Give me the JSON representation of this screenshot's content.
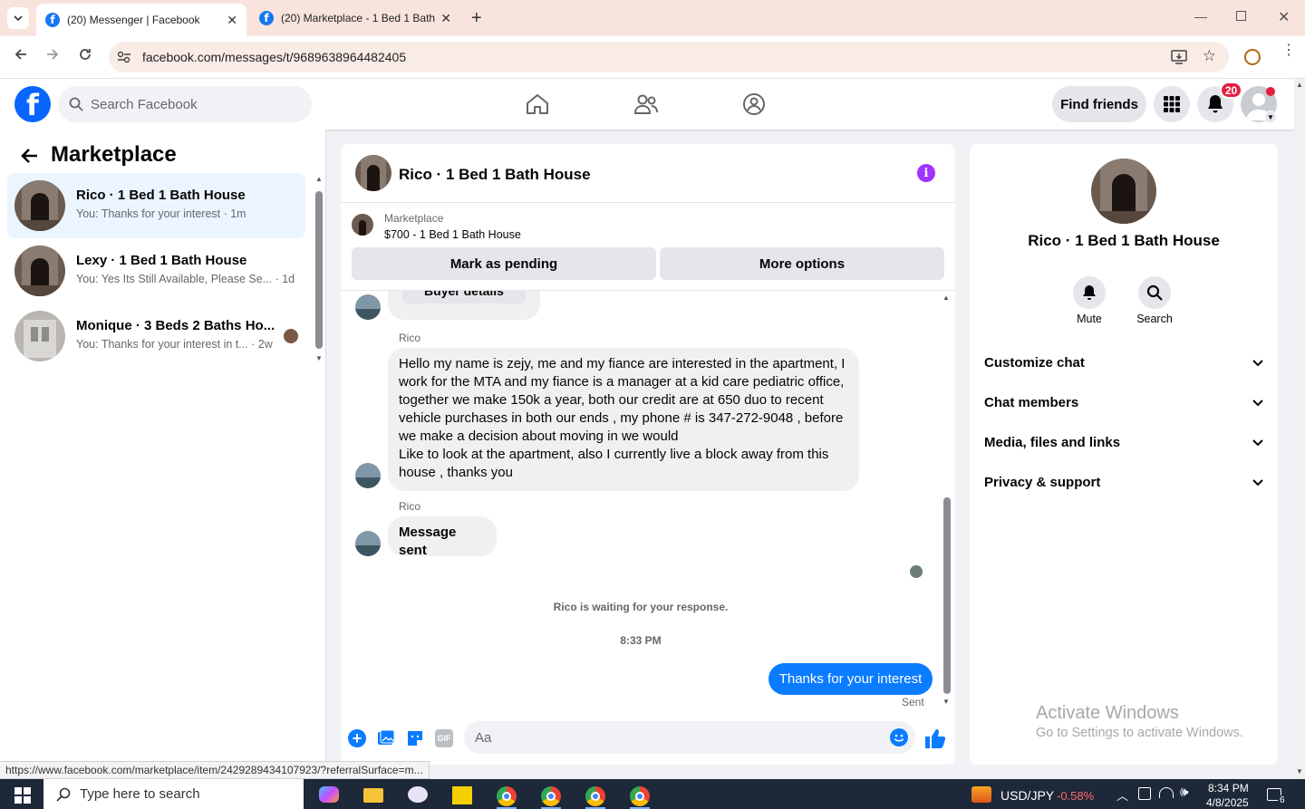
{
  "browser": {
    "tabs": [
      {
        "title": "(20) Messenger | Facebook",
        "active": true
      },
      {
        "title": "(20) Marketplace - 1 Bed 1 Bath",
        "active": false
      }
    ],
    "url": "facebook.com/messages/t/9689638964482405",
    "status_url": "https://www.facebook.com/marketplace/item/2429289434107923/?referralSurface=m..."
  },
  "fb": {
    "search_placeholder": "Search Facebook",
    "find_friends": "Find friends",
    "notification_count": "20"
  },
  "left": {
    "title": "Marketplace",
    "conversations": [
      {
        "name": "Rico · 1 Bed 1 Bath House",
        "snippet": "You: Thanks for your interest · 1m",
        "selected": true
      },
      {
        "name": "Lexy · 1 Bed 1 Bath House",
        "snippet": "You: Yes Its Still Available, Please Se... · 1d",
        "selected": false
      },
      {
        "name": "Monique · 3 Beds 2 Baths Ho...",
        "snippet": "You: Thanks for your interest in t... · 2w",
        "selected": false
      }
    ]
  },
  "chat": {
    "title": "Rico · 1 Bed 1 Bath House",
    "listing_label": "Marketplace",
    "listing_detail": "$700 - 1 Bed 1 Bath House",
    "mark_pending": "Mark as pending",
    "more_options": "More options",
    "buyer_details": "Buyer details",
    "sender1": "Rico",
    "message1": "Hello my name is zejy, me and my fiance are interested in the apartment, I work for the MTA and my fiance is a manager at a kid care pediatric office, together we make 150k a year, both our credit are at 650 duo to recent vehicle purchases in both our ends , my phone # is 347-272-9048 , before we make a decision about moving in we would\nLike to look at the apartment, also I currently live a block away from this house , thanks you",
    "sender2": "Rico",
    "message2": "Message sent",
    "waiting": "Rico is waiting for your response.",
    "timestamp": "8:33 PM",
    "my_message": "Thanks for your interest",
    "sent_status": "Sent",
    "composer_placeholder": "Aa"
  },
  "right": {
    "name": "Rico · 1 Bed 1 Bath House",
    "mute_label": "Mute",
    "search_label": "Search",
    "sections": [
      "Customize chat",
      "Chat members",
      "Media, files and links",
      "Privacy & support"
    ]
  },
  "watermark": {
    "title": "Activate Windows",
    "subtitle": "Go to Settings to activate Windows."
  },
  "taskbar": {
    "search_placeholder": "Type here to search",
    "ticker_name": "USD/JPY",
    "ticker_change": "-0.58%",
    "time": "8:34 PM",
    "date": "4/8/2025",
    "notif_count": "6"
  },
  "colors": {
    "fb_blue": "#0866ff",
    "accent_purple": "#a033ff",
    "my_bubble": "#0a7cff",
    "ticker_red": "#ff6b6b"
  }
}
